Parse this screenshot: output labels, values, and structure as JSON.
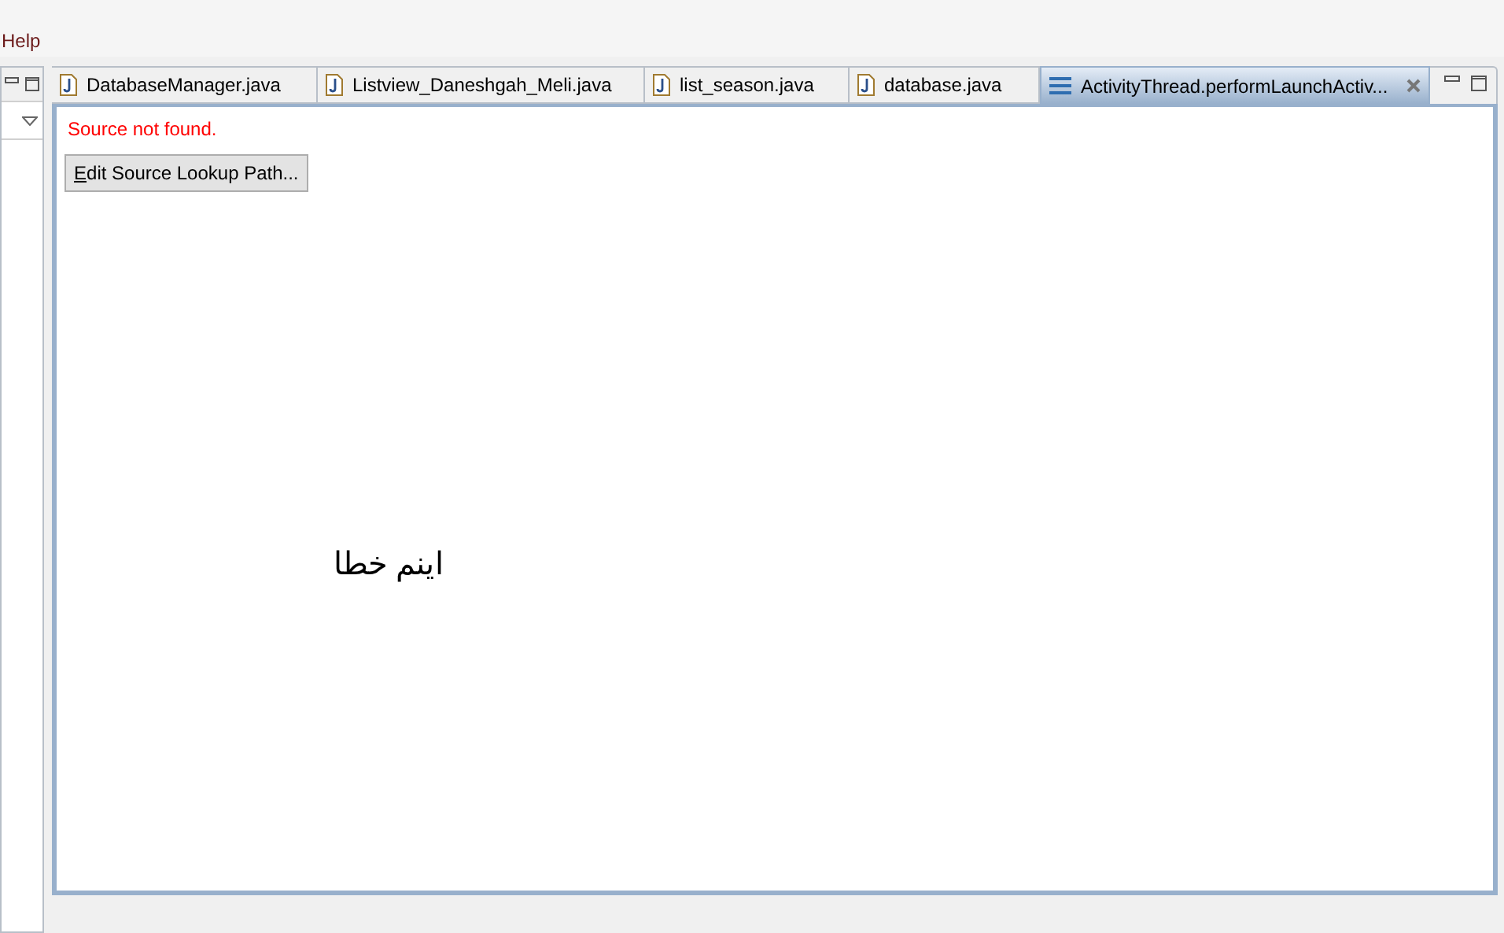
{
  "menu": [
    {
      "label": "Help"
    }
  ],
  "editor_tabs": [
    {
      "label": "DatabaseManager.java",
      "kind": "java",
      "selected": false
    },
    {
      "label": "Listview_Daneshgah_Meli.java",
      "kind": "java",
      "selected": false
    },
    {
      "label": "list_season.java",
      "kind": "java",
      "selected": false
    },
    {
      "label": "database.java",
      "kind": "java",
      "selected": false
    },
    {
      "label": "ActivityThread.performLaunchActiv...",
      "kind": "class",
      "selected": true
    }
  ],
  "editor": {
    "message": "Source not found.",
    "button": "Edit Source Lookup Path...",
    "annotation": "اینم خطا"
  }
}
